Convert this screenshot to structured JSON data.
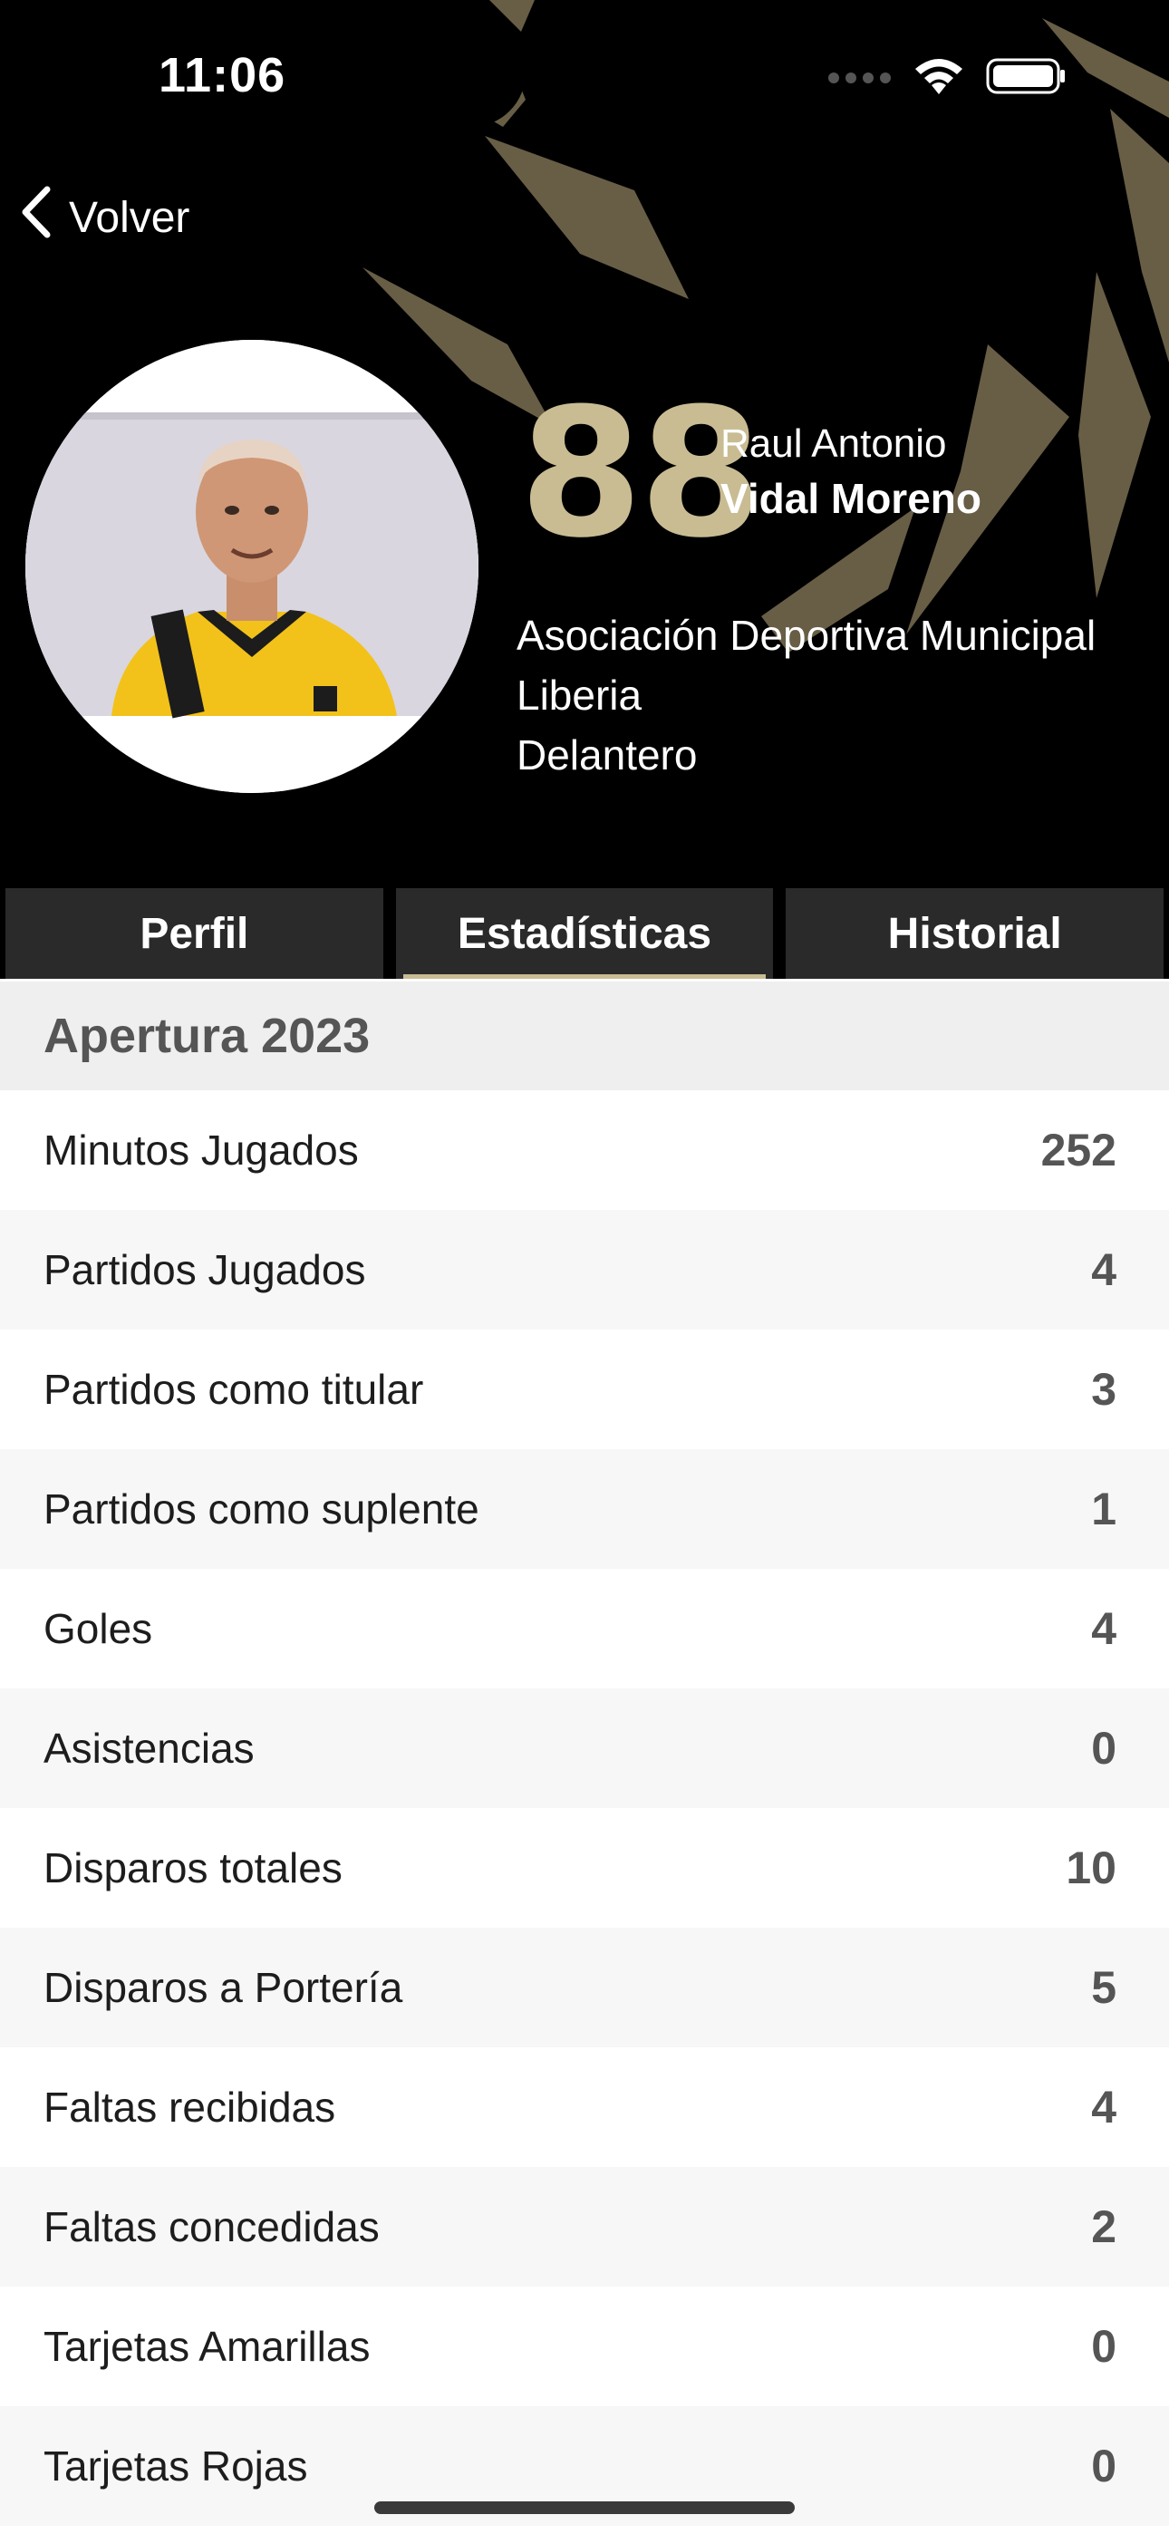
{
  "status_bar": {
    "time": "11:06"
  },
  "nav": {
    "back_label": "Volver"
  },
  "player": {
    "number": "88",
    "first_name": "Raul Antonio",
    "last_name": "Vidal Moreno",
    "club_line1": "Asociación Deportiva Municipal",
    "club_line2": "Liberia",
    "position": "Delantero"
  },
  "tabs": [
    {
      "label": "Perfil",
      "active": false
    },
    {
      "label": "Estadísticas",
      "active": true
    },
    {
      "label": "Historial",
      "active": false
    }
  ],
  "season": {
    "title": "Apertura 2023"
  },
  "stats": [
    {
      "label": "Minutos Jugados",
      "value": "252"
    },
    {
      "label": "Partidos Jugados",
      "value": "4"
    },
    {
      "label": "Partidos como titular",
      "value": "3"
    },
    {
      "label": "Partidos como suplente",
      "value": "1"
    },
    {
      "label": "Goles",
      "value": "4"
    },
    {
      "label": "Asistencias",
      "value": "0"
    },
    {
      "label": "Disparos totales",
      "value": "10"
    },
    {
      "label": "Disparos a Portería",
      "value": "5"
    },
    {
      "label": "Faltas recibidas",
      "value": "4"
    },
    {
      "label": "Faltas concedidas",
      "value": "2"
    },
    {
      "label": "Tarjetas Amarillas",
      "value": "0"
    },
    {
      "label": "Tarjetas Rojas",
      "value": "0"
    }
  ],
  "colors": {
    "header_bg": "#000000",
    "accent_gold": "#c9bc93",
    "tab_bg": "#2a2a2a",
    "jersey_yellow": "#f2c21a"
  }
}
